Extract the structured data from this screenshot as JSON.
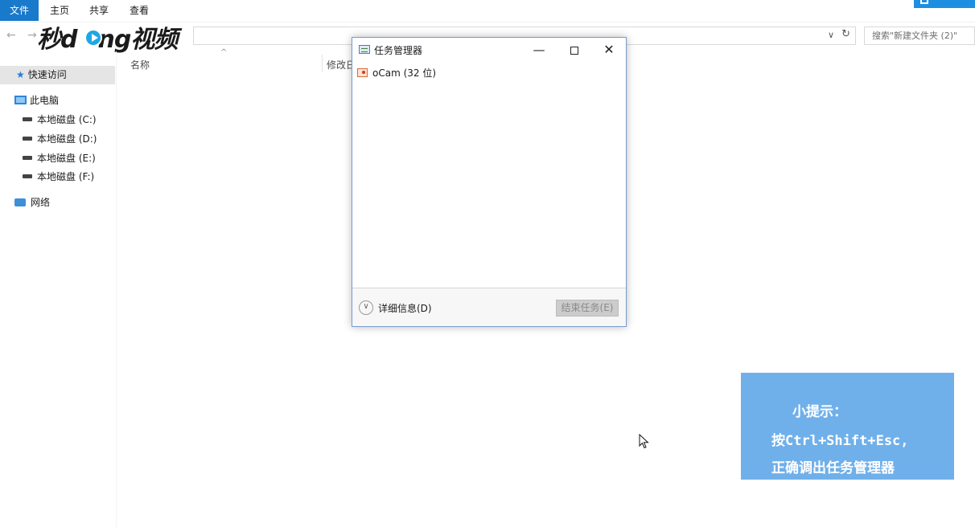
{
  "ribbon": {
    "tabs": [
      "文件",
      "主页",
      "共享",
      "查看"
    ]
  },
  "nav": {
    "back_icon": "←",
    "forward_icon": "→",
    "dropdown_icon": "∨",
    "refresh_icon": "↻",
    "search_placeholder": "搜索\"新建文件夹 (2)\""
  },
  "watermark": {
    "text_prefix": "秒d",
    "text_suffix": "ng视频"
  },
  "sidebar": {
    "quick_access": "快速访问",
    "this_pc": "此电脑",
    "drives": [
      "本地磁盘 (C:)",
      "本地磁盘 (D:)",
      "本地磁盘 (E:)",
      "本地磁盘 (F:)"
    ],
    "network": "网络"
  },
  "file_list": {
    "columns": [
      "名称",
      "修改日"
    ],
    "sort_icon": "^"
  },
  "task_manager": {
    "title": "任务管理器",
    "minimize_icon": "—",
    "close_icon": "✕",
    "apps": [
      {
        "name": "oCam (32 位)"
      }
    ],
    "more_details": "详细信息(D)",
    "end_task": "结束任务(E)"
  },
  "tip": {
    "title": "小提示：",
    "line1": "按Ctrl+Shift+Esc,",
    "line2": "正确调出任务管理器"
  },
  "colors": {
    "file_tab": "#1979ca",
    "tip_bg": "#6fb0ea",
    "selected_sidebar": "#e5e5e5"
  }
}
